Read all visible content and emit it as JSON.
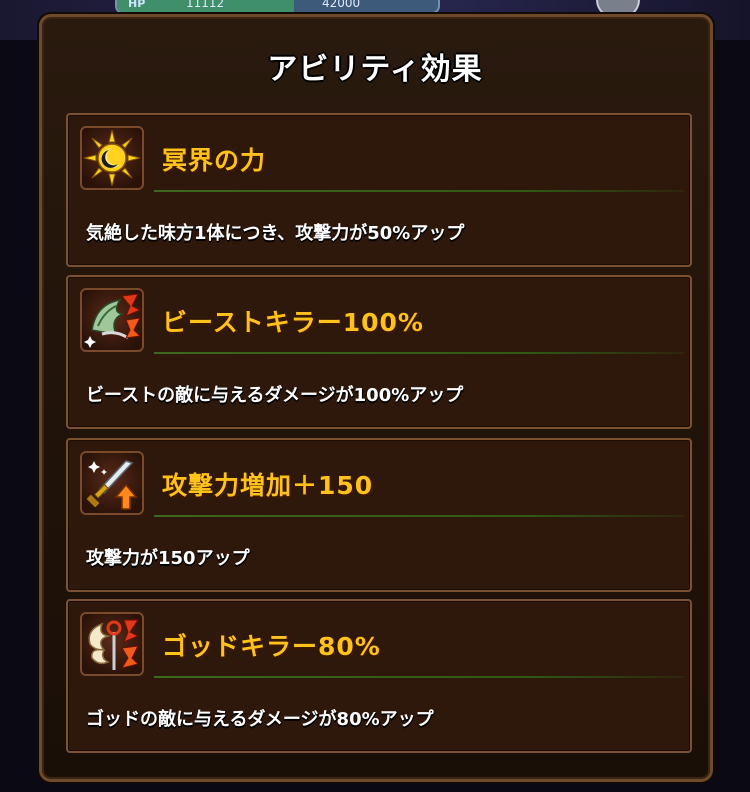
{
  "background": {
    "hp_label": "HP",
    "hp_value": "11112",
    "hp_max": "42000",
    "hp_fill_fraction": 0.55
  },
  "modal": {
    "title": "アビリティ効果"
  },
  "abilities": [
    {
      "icon": "sun-moon-icon",
      "name": "冥界の力",
      "description": "気絶した味方1体につき、攻撃力が50%アップ"
    },
    {
      "icon": "beast-claw-icon",
      "name": "ビーストキラー100%",
      "description": "ビーストの敵に与えるダメージが100%アップ"
    },
    {
      "icon": "sword-up-arrow-icon",
      "name": "攻撃力増加＋150",
      "description": "攻撃力が150アップ"
    },
    {
      "icon": "god-wing-staff-icon",
      "name": "ゴッドキラー80%",
      "description": "ゴッドの敵に与えるダメージが80%アップ"
    }
  ],
  "colors": {
    "title_text": "#ffffff",
    "ability_name": "#ffc21a",
    "description_text": "#ffffff",
    "card_background": "#2e180b",
    "card_border": "#7a5230",
    "divider": "#3a6a1a"
  }
}
